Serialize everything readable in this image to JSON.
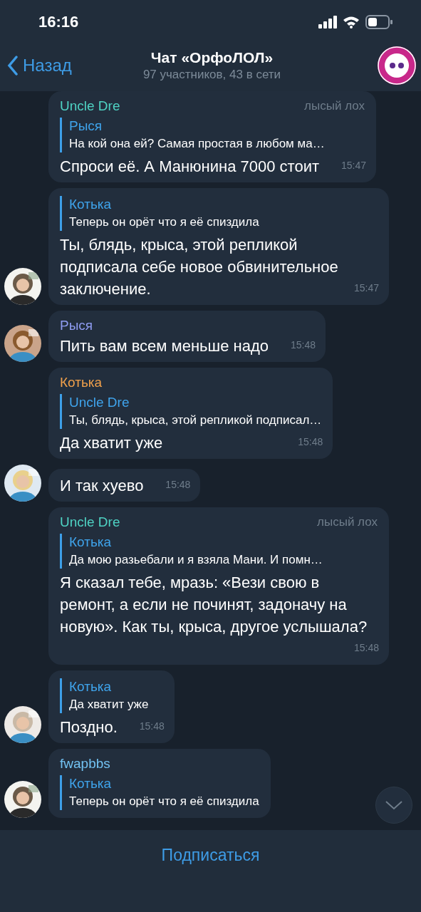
{
  "status_bar": {
    "time": "16:16"
  },
  "header": {
    "back": "Назад",
    "title": "Чат «ОрфоЛОЛ»",
    "subtitle": "97 участников, 43 в сети"
  },
  "messages": [
    {
      "sender": "Uncle Dre",
      "color": "#4fd3c4",
      "admin_title": "лысый лох",
      "reply": {
        "name": "Рыся",
        "text": "На кой она ей? Самая простая в любом ма…"
      },
      "text": "Спроси её. А Манюнина 7000 стоит",
      "time": "15:47",
      "avatar": false
    },
    {
      "reply": {
        "name": "Котька",
        "text": "Теперь он орёт что я её спиздила"
      },
      "text": "Ты, блядь, крыса, этой репликой подписала себе новое обвинительное заключение.",
      "time": "15:47",
      "avatar": true
    },
    {
      "sender": "Рыся",
      "color": "#8f9cf2",
      "text": "Пить вам всем меньше надо",
      "time": "15:48",
      "avatar": true
    },
    {
      "sender": "Котька",
      "color": "#f0a04b",
      "reply": {
        "name": "Uncle Dre",
        "text": "Ты, блядь, крыса, этой репликой подписал…"
      },
      "text": "Да хватит уже",
      "time": "15:48",
      "avatar": false
    },
    {
      "text": "И так хуево",
      "time": "15:48",
      "avatar": true
    },
    {
      "sender": "Uncle Dre",
      "color": "#4fd3c4",
      "admin_title": "лысый лох",
      "reply": {
        "name": "Котька",
        "text": "Да мою разьебали и я взяла Мани. И помн…"
      },
      "text": "Я сказал тебе, мразь: «Вези свою в ремонт, а если не починят, задоначу на новую». Как ты, крыса, другое услышала?",
      "time": "15:48",
      "avatar": false
    },
    {
      "reply": {
        "name": "Котька",
        "text": "Да хватит уже"
      },
      "text": "Поздно.",
      "time": "15:48",
      "avatar": true
    },
    {
      "sender": "fwapbbs",
      "color": "#72c2f2",
      "reply": {
        "name": "Котька",
        "text": "Теперь он орёт что я её спиздила"
      },
      "avatar": true
    }
  ],
  "footer": {
    "button": "Подписаться"
  }
}
